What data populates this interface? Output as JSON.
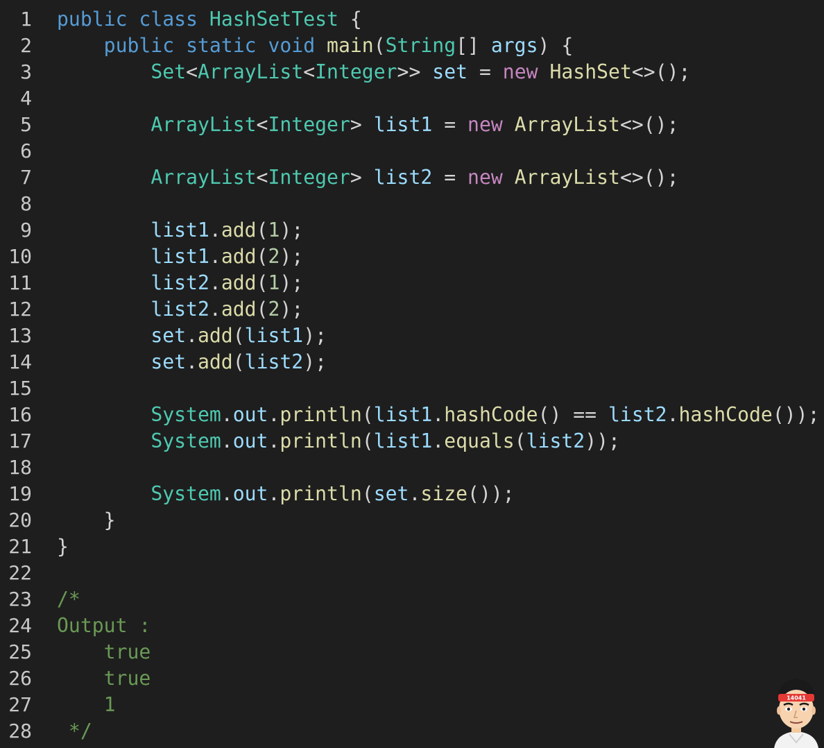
{
  "editor": {
    "lines": [
      {
        "n": "1",
        "tokens": [
          [
            "kw",
            "public"
          ],
          [
            "pn",
            " "
          ],
          [
            "kw",
            "class"
          ],
          [
            "pn",
            " "
          ],
          [
            "ty",
            "HashSetTest"
          ],
          [
            "pn",
            " {"
          ]
        ]
      },
      {
        "n": "2",
        "tokens": [
          [
            "pn",
            "    "
          ],
          [
            "kw",
            "public"
          ],
          [
            "pn",
            " "
          ],
          [
            "kw",
            "static"
          ],
          [
            "pn",
            " "
          ],
          [
            "kw",
            "void"
          ],
          [
            "pn",
            " "
          ],
          [
            "fn",
            "main"
          ],
          [
            "pn",
            "("
          ],
          [
            "ty",
            "String"
          ],
          [
            "pn",
            "[] "
          ],
          [
            "var",
            "args"
          ],
          [
            "pn",
            ") {"
          ]
        ]
      },
      {
        "n": "3",
        "tokens": [
          [
            "pn",
            "        "
          ],
          [
            "ty",
            "Set"
          ],
          [
            "pn",
            "<"
          ],
          [
            "ty",
            "ArrayList"
          ],
          [
            "pn",
            "<"
          ],
          [
            "ty",
            "Integer"
          ],
          [
            "pn",
            ">> "
          ],
          [
            "var",
            "set"
          ],
          [
            "pn",
            " = "
          ],
          [
            "kw2",
            "new"
          ],
          [
            "pn",
            " "
          ],
          [
            "fn",
            "HashSet"
          ],
          [
            "pn",
            "<>();"
          ]
        ]
      },
      {
        "n": "4",
        "tokens": []
      },
      {
        "n": "5",
        "tokens": [
          [
            "pn",
            "        "
          ],
          [
            "ty",
            "ArrayList"
          ],
          [
            "pn",
            "<"
          ],
          [
            "ty",
            "Integer"
          ],
          [
            "pn",
            "> "
          ],
          [
            "var",
            "list1"
          ],
          [
            "pn",
            " = "
          ],
          [
            "kw2",
            "new"
          ],
          [
            "pn",
            " "
          ],
          [
            "fn",
            "ArrayList"
          ],
          [
            "pn",
            "<>();"
          ]
        ]
      },
      {
        "n": "6",
        "tokens": []
      },
      {
        "n": "7",
        "tokens": [
          [
            "pn",
            "        "
          ],
          [
            "ty",
            "ArrayList"
          ],
          [
            "pn",
            "<"
          ],
          [
            "ty",
            "Integer"
          ],
          [
            "pn",
            "> "
          ],
          [
            "var",
            "list2"
          ],
          [
            "pn",
            " = "
          ],
          [
            "kw2",
            "new"
          ],
          [
            "pn",
            " "
          ],
          [
            "fn",
            "ArrayList"
          ],
          [
            "pn",
            "<>();"
          ]
        ]
      },
      {
        "n": "8",
        "tokens": []
      },
      {
        "n": "9",
        "tokens": [
          [
            "pn",
            "        "
          ],
          [
            "var",
            "list1"
          ],
          [
            "pn",
            "."
          ],
          [
            "fn",
            "add"
          ],
          [
            "pn",
            "("
          ],
          [
            "num",
            "1"
          ],
          [
            "pn",
            ");"
          ]
        ]
      },
      {
        "n": "10",
        "tokens": [
          [
            "pn",
            "        "
          ],
          [
            "var",
            "list1"
          ],
          [
            "pn",
            "."
          ],
          [
            "fn",
            "add"
          ],
          [
            "pn",
            "("
          ],
          [
            "num",
            "2"
          ],
          [
            "pn",
            ");"
          ]
        ]
      },
      {
        "n": "11",
        "tokens": [
          [
            "pn",
            "        "
          ],
          [
            "var",
            "list2"
          ],
          [
            "pn",
            "."
          ],
          [
            "fn",
            "add"
          ],
          [
            "pn",
            "("
          ],
          [
            "num",
            "1"
          ],
          [
            "pn",
            ");"
          ]
        ]
      },
      {
        "n": "12",
        "tokens": [
          [
            "pn",
            "        "
          ],
          [
            "var",
            "list2"
          ],
          [
            "pn",
            "."
          ],
          [
            "fn",
            "add"
          ],
          [
            "pn",
            "("
          ],
          [
            "num",
            "2"
          ],
          [
            "pn",
            ");"
          ]
        ]
      },
      {
        "n": "13",
        "tokens": [
          [
            "pn",
            "        "
          ],
          [
            "var",
            "set"
          ],
          [
            "pn",
            "."
          ],
          [
            "fn",
            "add"
          ],
          [
            "pn",
            "("
          ],
          [
            "var",
            "list1"
          ],
          [
            "pn",
            ");"
          ]
        ]
      },
      {
        "n": "14",
        "tokens": [
          [
            "pn",
            "        "
          ],
          [
            "var",
            "set"
          ],
          [
            "pn",
            "."
          ],
          [
            "fn",
            "add"
          ],
          [
            "pn",
            "("
          ],
          [
            "var",
            "list2"
          ],
          [
            "pn",
            ");"
          ]
        ]
      },
      {
        "n": "15",
        "tokens": []
      },
      {
        "n": "16",
        "tokens": [
          [
            "pn",
            "        "
          ],
          [
            "ty",
            "System"
          ],
          [
            "pn",
            "."
          ],
          [
            "var",
            "out"
          ],
          [
            "pn",
            "."
          ],
          [
            "fn",
            "println"
          ],
          [
            "pn",
            "("
          ],
          [
            "var",
            "list1"
          ],
          [
            "pn",
            "."
          ],
          [
            "fn",
            "hashCode"
          ],
          [
            "pn",
            "() == "
          ],
          [
            "var",
            "list2"
          ],
          [
            "pn",
            "."
          ],
          [
            "fn",
            "hashCode"
          ],
          [
            "pn",
            "());"
          ]
        ]
      },
      {
        "n": "17",
        "tokens": [
          [
            "pn",
            "        "
          ],
          [
            "ty",
            "System"
          ],
          [
            "pn",
            "."
          ],
          [
            "var",
            "out"
          ],
          [
            "pn",
            "."
          ],
          [
            "fn",
            "println"
          ],
          [
            "pn",
            "("
          ],
          [
            "var",
            "list1"
          ],
          [
            "pn",
            "."
          ],
          [
            "fn",
            "equals"
          ],
          [
            "pn",
            "("
          ],
          [
            "var",
            "list2"
          ],
          [
            "pn",
            "));"
          ]
        ]
      },
      {
        "n": "18",
        "tokens": []
      },
      {
        "n": "19",
        "tokens": [
          [
            "pn",
            "        "
          ],
          [
            "ty",
            "System"
          ],
          [
            "pn",
            "."
          ],
          [
            "var",
            "out"
          ],
          [
            "pn",
            "."
          ],
          [
            "fn",
            "println"
          ],
          [
            "pn",
            "("
          ],
          [
            "var",
            "set"
          ],
          [
            "pn",
            "."
          ],
          [
            "fn",
            "size"
          ],
          [
            "pn",
            "());"
          ]
        ]
      },
      {
        "n": "20",
        "tokens": [
          [
            "pn",
            "    }"
          ]
        ]
      },
      {
        "n": "21",
        "tokens": [
          [
            "pn",
            "}"
          ]
        ]
      },
      {
        "n": "22",
        "tokens": []
      },
      {
        "n": "23",
        "tokens": [
          [
            "cm",
            "/*"
          ]
        ]
      },
      {
        "n": "24",
        "tokens": [
          [
            "cm",
            "Output :"
          ]
        ]
      },
      {
        "n": "25",
        "tokens": [
          [
            "cm",
            "    true"
          ]
        ]
      },
      {
        "n": "26",
        "tokens": [
          [
            "cm",
            "    true"
          ]
        ]
      },
      {
        "n": "27",
        "tokens": [
          [
            "cm",
            "    1"
          ]
        ]
      },
      {
        "n": "28",
        "tokens": [
          [
            "cm",
            " */"
          ]
        ]
      }
    ]
  },
  "watermark": {
    "badge_text": "14041",
    "icon": "avatar-icon",
    "headband_color": "#e53935"
  }
}
